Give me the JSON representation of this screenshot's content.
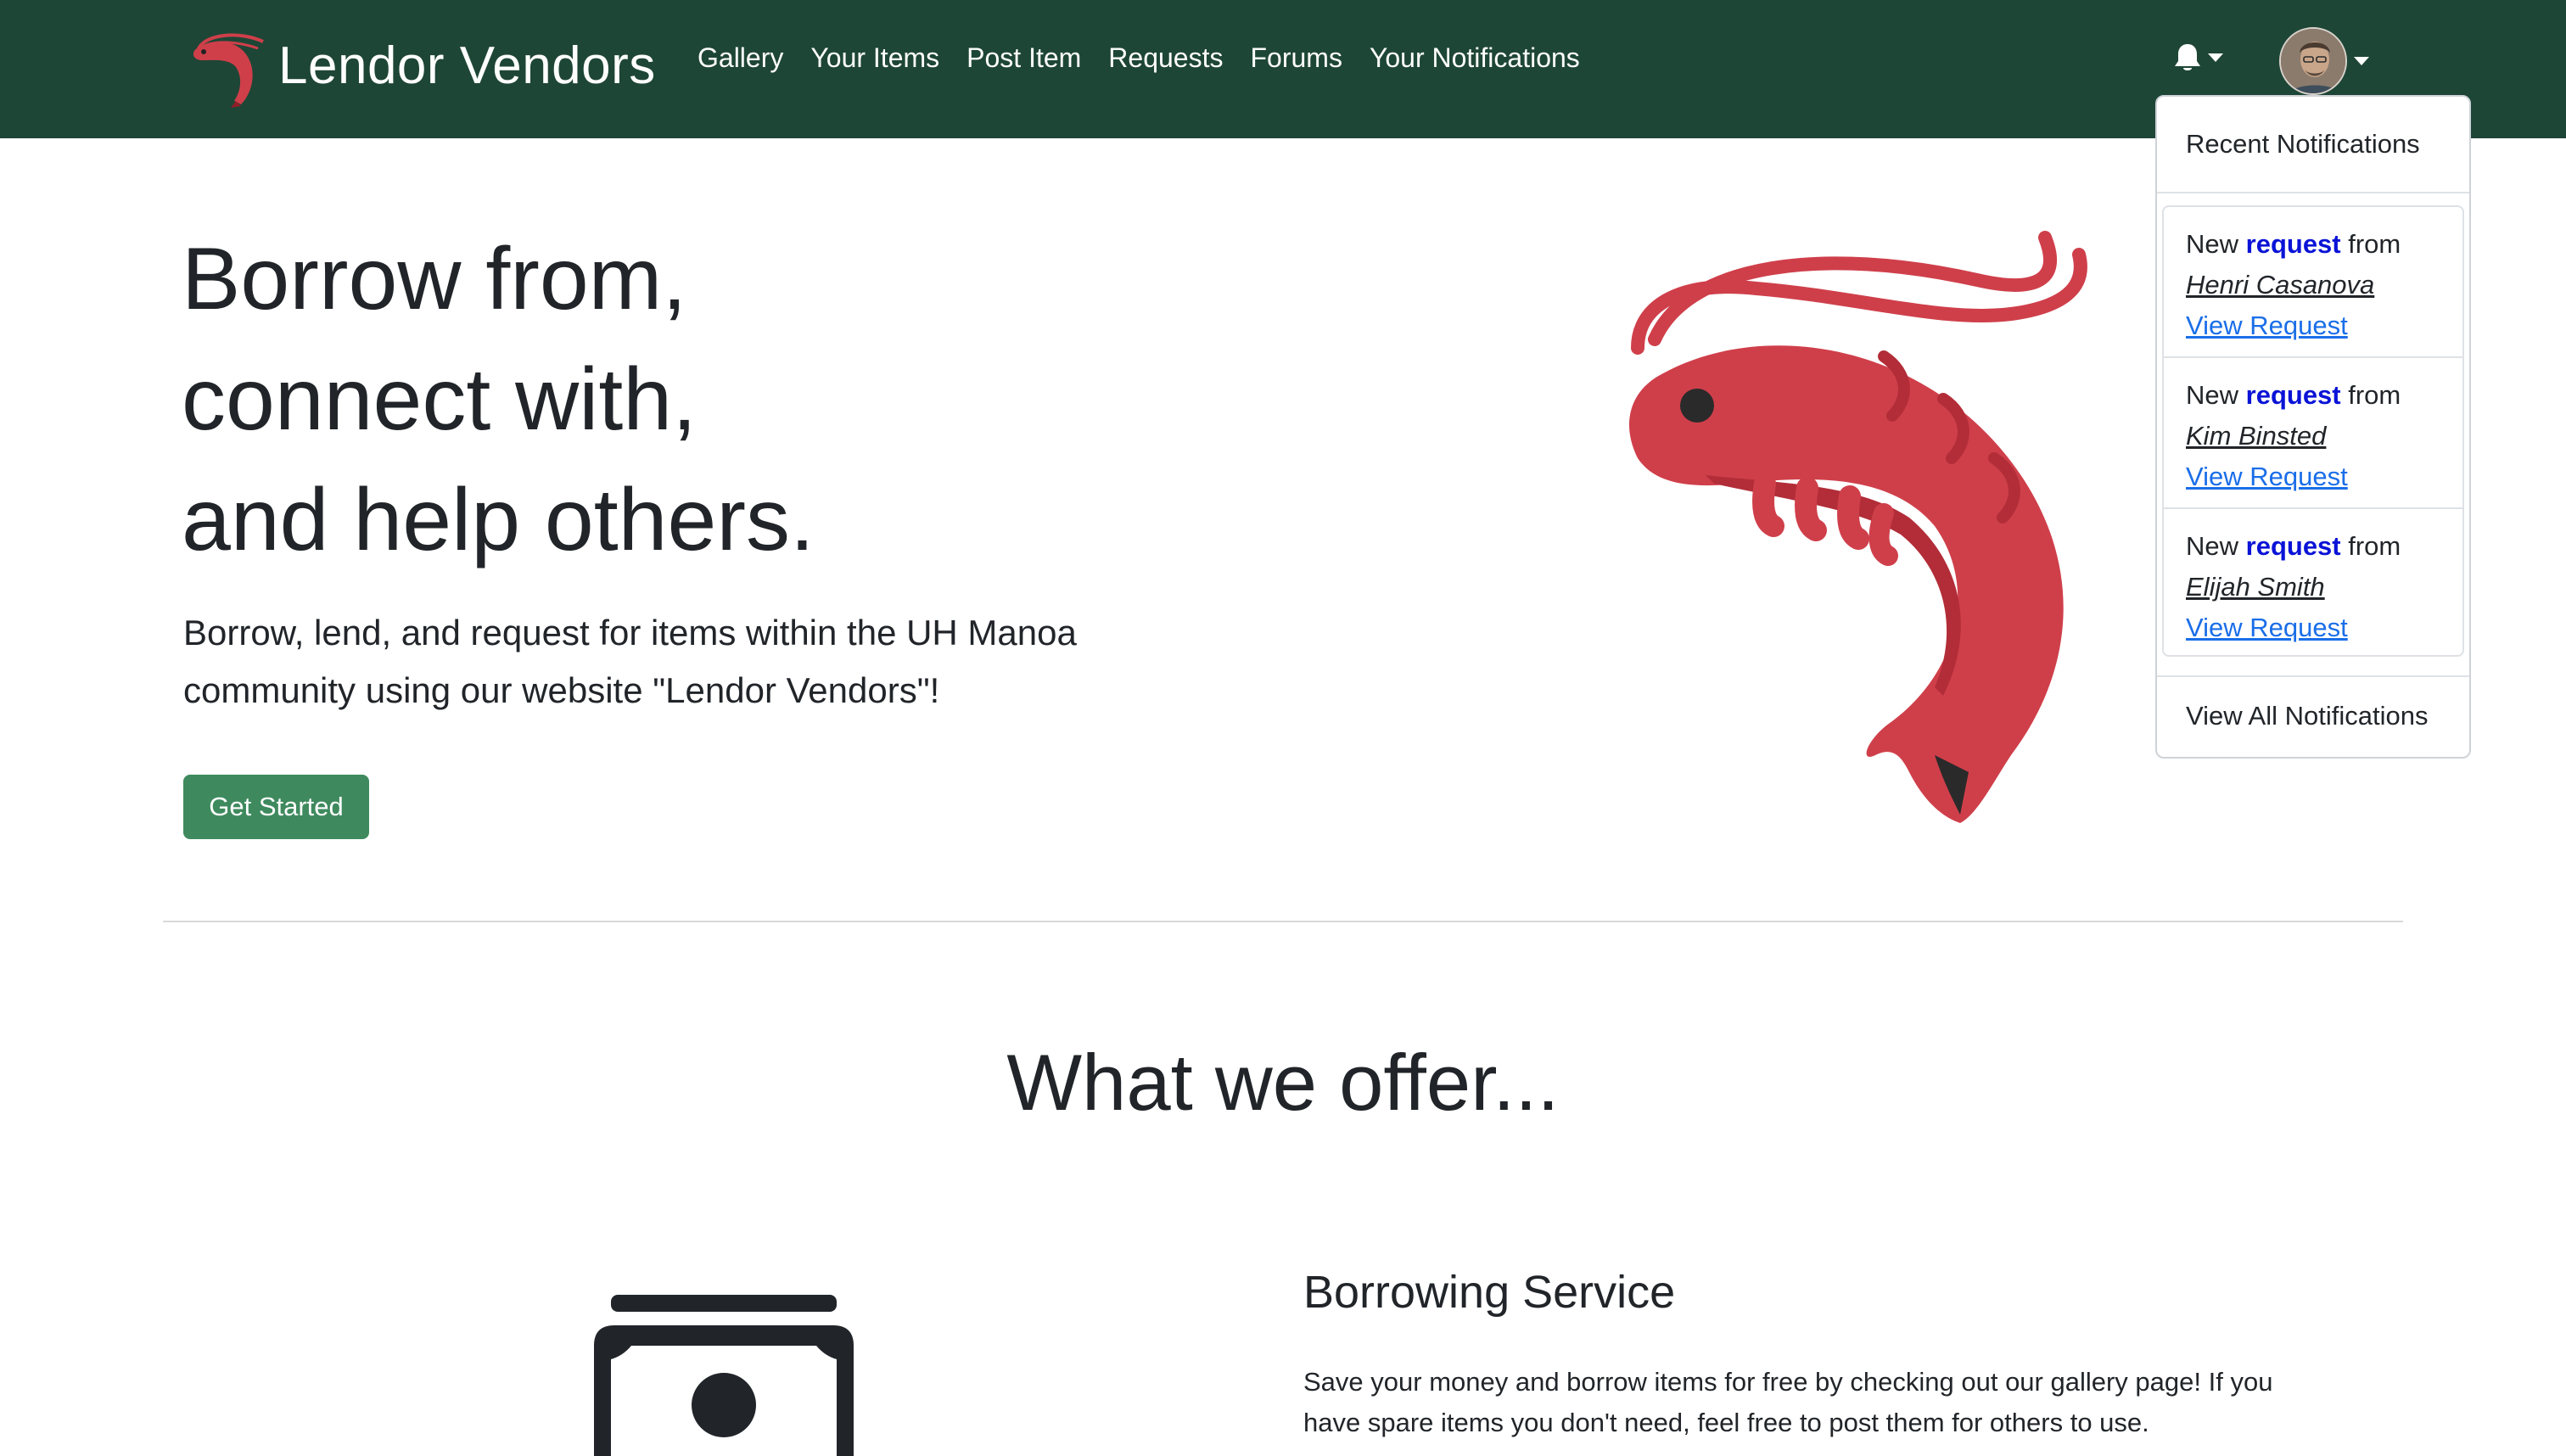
{
  "nav": {
    "brand": "Lendor Vendors",
    "links": [
      "Gallery",
      "Your Items",
      "Post Item",
      "Requests",
      "Forums",
      "Your Notifications"
    ]
  },
  "hero": {
    "title_lines": [
      "Borrow from,",
      "connect with,",
      "and help others."
    ],
    "subtitle_lines": [
      "Borrow, lend, and request for items within the UH Manoa",
      "community using our website \"Lendor Vendors\"!"
    ],
    "cta": "Get Started"
  },
  "offer": {
    "heading": "What we offer...",
    "service_title": "Borrowing Service",
    "service_desc_lines": [
      "Save your money and borrow items for free by checking out our gallery page! If you",
      "have spare items you don't need, feel free to post them for others to use."
    ]
  },
  "notifications": {
    "header": "Recent Notifications",
    "prefix": "New",
    "keyword": "request",
    "from_word": "from",
    "link_label": "View Request",
    "items": [
      {
        "name": "Henri Casanova"
      },
      {
        "name": "Kim Binsted"
      },
      {
        "name": "Elijah Smith"
      }
    ],
    "footer": "View All Notifications"
  },
  "icons": {
    "brand_logo": "shrimp-icon",
    "bell": "bell-icon",
    "caret": "caret-down-icon",
    "avatar": "user-avatar",
    "hero_image": "shrimp-illustration",
    "service_icon": "money-bill-icon"
  },
  "colors": {
    "navbar": "#1e4636",
    "cta": "#3e8a5e",
    "shrimp": "#cf3f4a",
    "keyword": "#0a13d6",
    "link": "#1a6ee8"
  }
}
